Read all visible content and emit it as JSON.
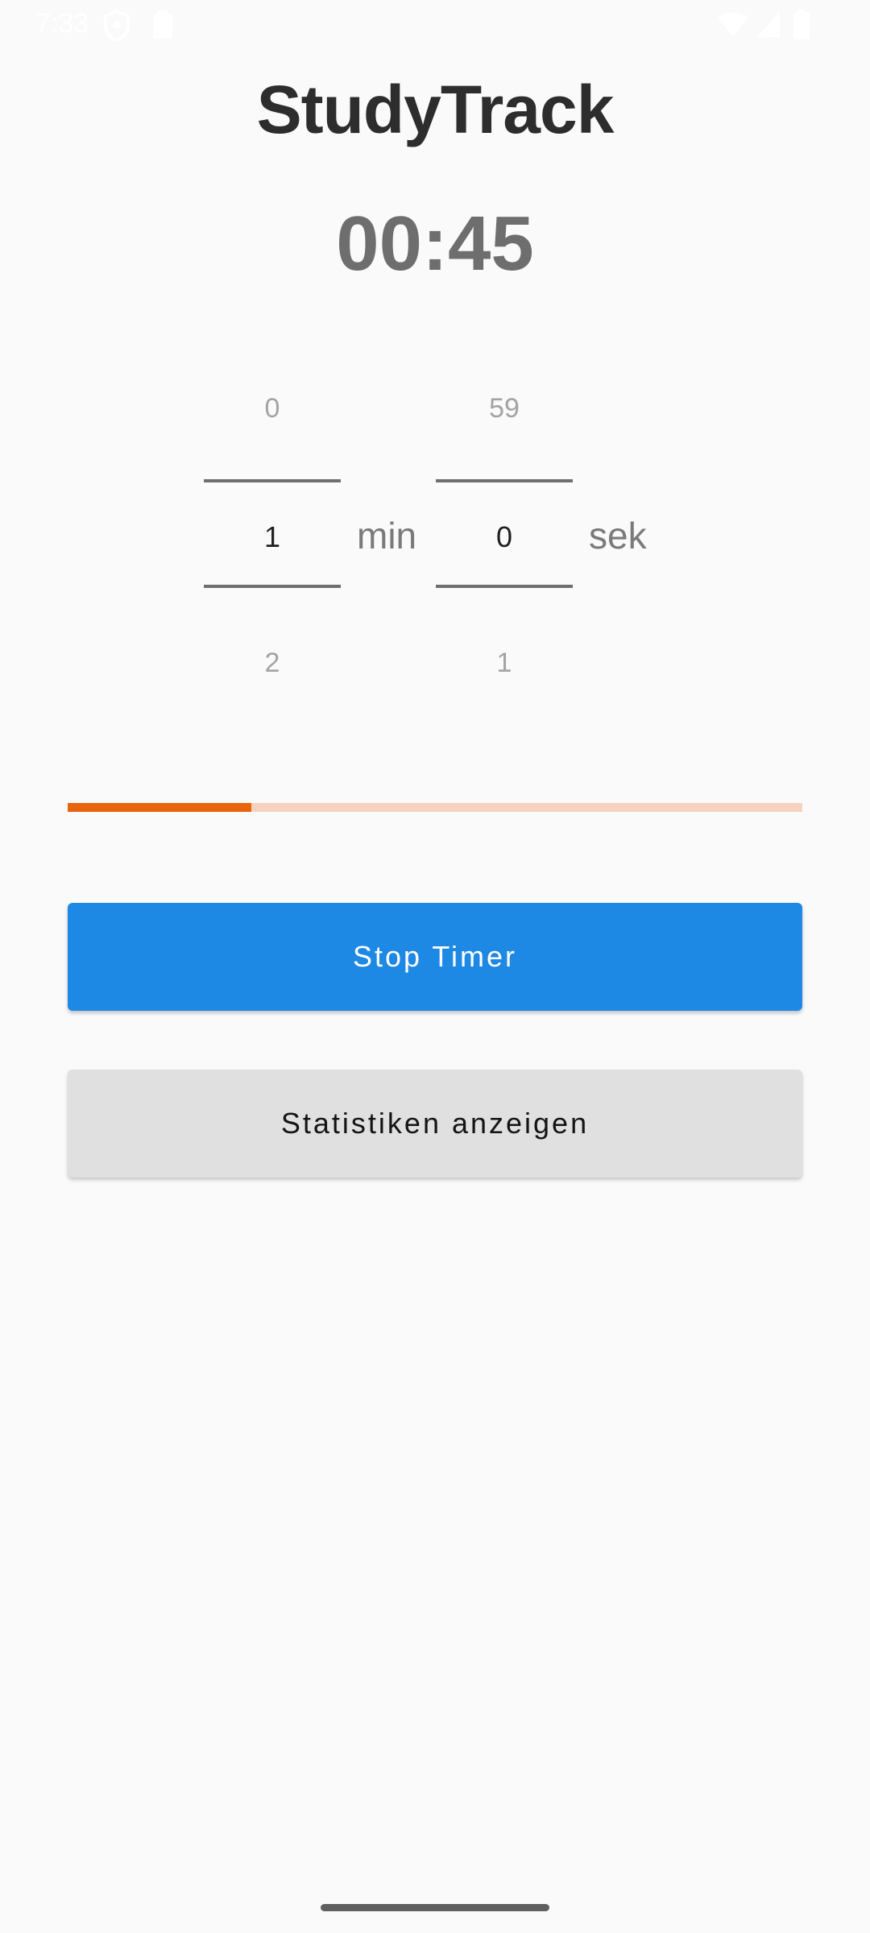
{
  "status_bar": {
    "time": "7:33",
    "icons": [
      "shield-icon",
      "clipboard-icon",
      "wifi-icon",
      "signal-icon",
      "battery-icon"
    ]
  },
  "app": {
    "title": "StudyTrack",
    "timer_display": "00:45"
  },
  "pickers": {
    "minutes": {
      "prev": "0",
      "current": "1",
      "next": "2",
      "unit": "min"
    },
    "seconds": {
      "prev": "59",
      "current": "0",
      "next": "1",
      "unit": "sek"
    }
  },
  "progress": {
    "fraction": 0.25,
    "fill_color": "#e8650e",
    "track_color": "#f6d3bf"
  },
  "buttons": {
    "stop_label": "Stop Timer",
    "stats_label": "Statistiken anzeigen",
    "primary_color": "#1e88e5"
  }
}
